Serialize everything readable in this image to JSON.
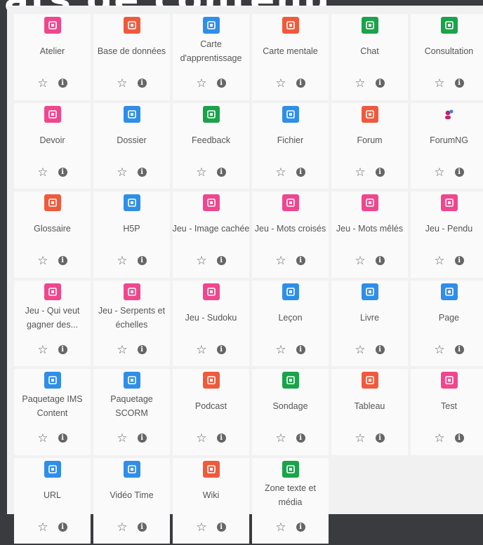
{
  "header": {
    "title": "ats de contenu"
  },
  "activities": [
    {
      "label": "Atelier",
      "icon": "workshop-icon",
      "color": "#f0468e"
    },
    {
      "label": "Base de données",
      "icon": "database-icon",
      "color": "#f05a3c"
    },
    {
      "label": "Carte d'apprentissage",
      "icon": "map-icon",
      "color": "#2f8ee8"
    },
    {
      "label": "Carte mentale",
      "icon": "mindmap-icon",
      "color": "#f05a3c"
    },
    {
      "label": "Chat",
      "icon": "chat-icon",
      "color": "#1aa34a"
    },
    {
      "label": "Consultation",
      "icon": "chart-bar-icon",
      "color": "#1aa34a"
    },
    {
      "label": "Devoir",
      "icon": "assignment-icon",
      "color": "#f0468e"
    },
    {
      "label": "Dossier",
      "icon": "folder-icon",
      "color": "#2f8ee8"
    },
    {
      "label": "Feedback",
      "icon": "megaphone-icon",
      "color": "#1aa34a"
    },
    {
      "label": "Fichier",
      "icon": "file-icon",
      "color": "#2f8ee8"
    },
    {
      "label": "Forum",
      "icon": "forum-icon",
      "color": "#f05a3c"
    },
    {
      "label": "ForumNG",
      "icon": "users-icon",
      "color": "#c0246a"
    },
    {
      "label": "Glossaire",
      "icon": "book-icon",
      "color": "#f05a3c"
    },
    {
      "label": "H5P",
      "icon": "h5p-icon",
      "color": "#2f8ee8"
    },
    {
      "label": "Jeu - Image cachée",
      "icon": "game-icon",
      "color": "#f0468e"
    },
    {
      "label": "Jeu - Mots croisés",
      "icon": "game-icon",
      "color": "#f0468e"
    },
    {
      "label": "Jeu - Mots mêlés",
      "icon": "game-icon",
      "color": "#f0468e"
    },
    {
      "label": "Jeu - Pendu",
      "icon": "game-icon",
      "color": "#f0468e"
    },
    {
      "label": "Jeu - Qui veut gagner des...",
      "icon": "game-icon",
      "color": "#f0468e"
    },
    {
      "label": "Jeu - Serpents et échelles",
      "icon": "game-icon",
      "color": "#f0468e"
    },
    {
      "label": "Jeu - Sudoku",
      "icon": "game-icon",
      "color": "#f0468e"
    },
    {
      "label": "Leçon",
      "icon": "lesson-icon",
      "color": "#2f8ee8"
    },
    {
      "label": "Livre",
      "icon": "open-book-icon",
      "color": "#2f8ee8"
    },
    {
      "label": "Page",
      "icon": "page-icon",
      "color": "#2f8ee8"
    },
    {
      "label": "Paquetage IMS Content",
      "icon": "package-icon",
      "color": "#2f8ee8"
    },
    {
      "label": "Paquetage SCORM",
      "icon": "scorm-icon",
      "color": "#2f8ee8"
    },
    {
      "label": "Podcast",
      "icon": "podcast-icon",
      "color": "#f05a3c"
    },
    {
      "label": "Sondage",
      "icon": "survey-icon",
      "color": "#1aa34a"
    },
    {
      "label": "Tableau",
      "icon": "board-icon",
      "color": "#f05a3c"
    },
    {
      "label": "Test",
      "icon": "quiz-icon",
      "color": "#f0468e"
    },
    {
      "label": "URL",
      "icon": "globe-icon",
      "color": "#2f8ee8"
    },
    {
      "label": "Vidéo Time",
      "icon": "play-icon",
      "color": "#2f8ee8"
    },
    {
      "label": "Wiki",
      "icon": "wiki-icon",
      "color": "#f05a3c"
    },
    {
      "label": "Zone texte et média",
      "icon": "text-media-icon",
      "color": "#1aa34a"
    }
  ],
  "actions": {
    "star_glyph": "☆",
    "info_glyph": "i"
  }
}
